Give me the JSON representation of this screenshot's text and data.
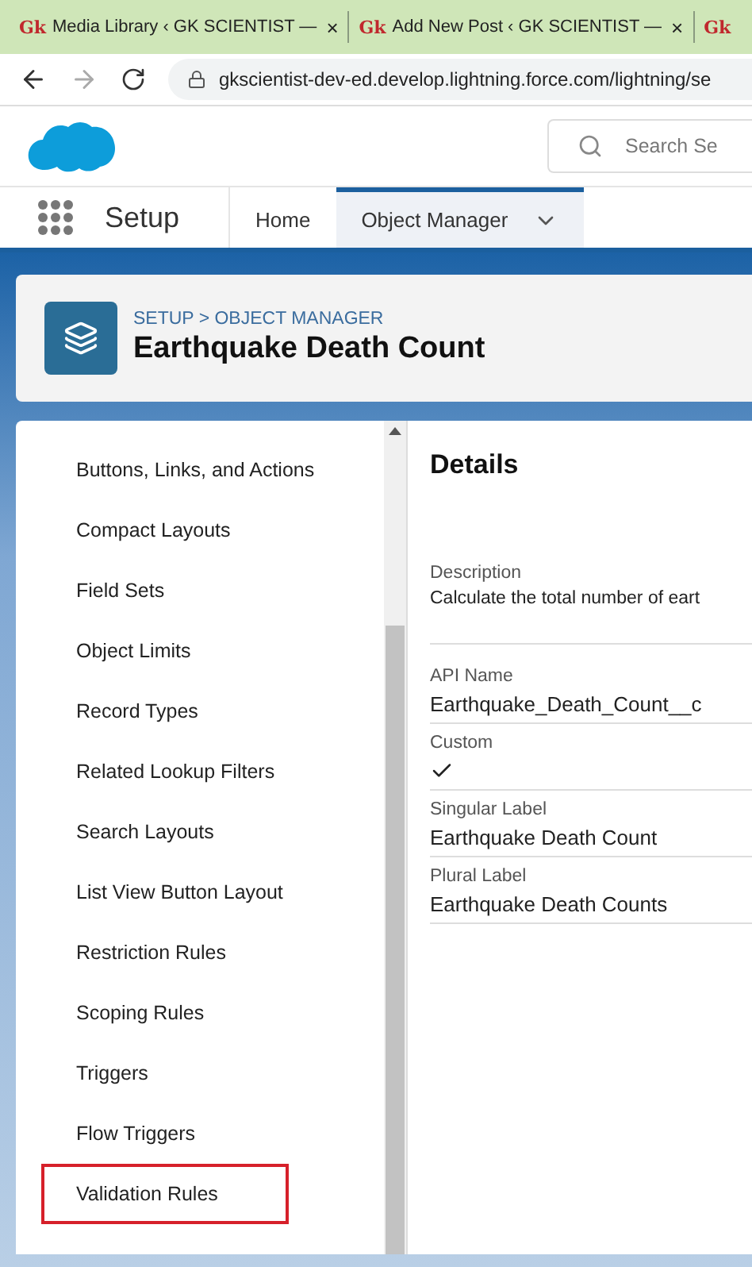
{
  "browser_tabs": [
    {
      "favicon": "Gk",
      "title": "Media Library ‹ GK SCIENTIST —",
      "close": "×"
    },
    {
      "favicon": "Gk",
      "title": "Add New Post ‹ GK SCIENTIST —",
      "close": "×"
    },
    {
      "favicon": "Gk"
    }
  ],
  "address_bar": {
    "url": "gkscientist-dev-ed.develop.lightning.force.com/lightning/se"
  },
  "header": {
    "search": {
      "placeholder": "Search Se"
    }
  },
  "nav": {
    "app_name": "Setup",
    "tabs": [
      {
        "label": "Home",
        "selected": false,
        "menu": false
      },
      {
        "label": "Object Manager",
        "selected": true,
        "menu": true
      }
    ]
  },
  "page_header": {
    "breadcrumb": "SETUP > OBJECT MANAGER",
    "title": "Earthquake Death Count"
  },
  "sidebar": {
    "items": [
      {
        "label": "Buttons, Links, and Actions",
        "highlighted": false
      },
      {
        "label": "Compact Layouts",
        "highlighted": false
      },
      {
        "label": "Field Sets",
        "highlighted": false
      },
      {
        "label": "Object Limits",
        "highlighted": false
      },
      {
        "label": "Record Types",
        "highlighted": false
      },
      {
        "label": "Related Lookup Filters",
        "highlighted": false
      },
      {
        "label": "Search Layouts",
        "highlighted": false
      },
      {
        "label": "List View Button Layout",
        "highlighted": false
      },
      {
        "label": "Restriction Rules",
        "highlighted": false
      },
      {
        "label": "Scoping Rules",
        "highlighted": false
      },
      {
        "label": "Triggers",
        "highlighted": false
      },
      {
        "label": "Flow Triggers",
        "highlighted": false
      },
      {
        "label": "Validation Rules",
        "highlighted": true
      }
    ]
  },
  "details": {
    "title": "Details",
    "fields": [
      {
        "label": "Description",
        "kind": "desc",
        "value": "Calculate the total number of eart"
      },
      {
        "label": "API Name",
        "kind": "text",
        "value": "Earthquake_Death_Count__c"
      },
      {
        "label": "Custom",
        "kind": "check",
        "checked": true
      },
      {
        "label": "Singular Label",
        "kind": "text",
        "value": "Earthquake Death Count"
      },
      {
        "label": "Plural Label",
        "kind": "text",
        "value": "Earthquake Death Counts"
      }
    ]
  }
}
